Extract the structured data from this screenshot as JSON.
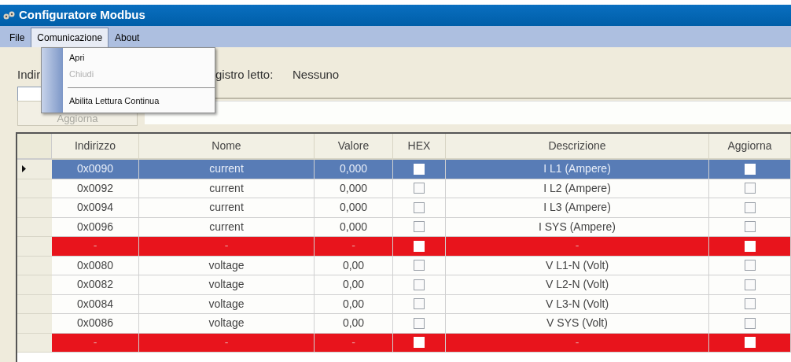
{
  "window": {
    "title": "Configuratore Modbus"
  },
  "menu_bar": [
    {
      "label": "File",
      "selected": false
    },
    {
      "label": "Comunicazione",
      "selected": true
    },
    {
      "label": "About",
      "selected": false
    }
  ],
  "open_menu": {
    "items": [
      {
        "label": "Apri",
        "disabled": false
      },
      {
        "label": "Chiudi",
        "disabled": true
      },
      {
        "kind": "separator"
      },
      {
        "label": "Abilita Lettura Continua",
        "disabled": false
      }
    ]
  },
  "form": {
    "address_label": "Indir",
    "register_label": "gistro letto:",
    "register_value": "Nessuno",
    "update_button": {
      "label": "Aggiorna",
      "disabled": true
    }
  },
  "table": {
    "columns": [
      "Indirizzo",
      "Nome",
      "Valore",
      "HEX",
      "Descrizione",
      "Aggiorna"
    ],
    "rows": [
      {
        "kind": "register",
        "selected": true,
        "address": "0x0090",
        "name": "current",
        "value": "0,000",
        "hex": false,
        "description": "I L1  (Ampere)",
        "update": false
      },
      {
        "kind": "register",
        "selected": false,
        "address": "0x0092",
        "name": "current",
        "value": "0,000",
        "hex": false,
        "description": "I L2  (Ampere)",
        "update": false
      },
      {
        "kind": "register",
        "selected": false,
        "address": "0x0094",
        "name": "current",
        "value": "0,000",
        "hex": false,
        "description": "I L3  (Ampere)",
        "update": false
      },
      {
        "kind": "register",
        "selected": false,
        "address": "0x0096",
        "name": "current",
        "value": "0,000",
        "hex": false,
        "description": "I SYS  (Ampere)",
        "update": false
      },
      {
        "kind": "separator",
        "selected": false,
        "address": "-",
        "name": "-",
        "value": "-",
        "hex": false,
        "description": "-",
        "update": false
      },
      {
        "kind": "register",
        "selected": false,
        "address": "0x0080",
        "name": "voltage",
        "value": "0,00",
        "hex": false,
        "description": "V L1-N (Volt)",
        "update": false
      },
      {
        "kind": "register",
        "selected": false,
        "address": "0x0082",
        "name": "voltage",
        "value": "0,00",
        "hex": false,
        "description": "V L2-N  (Volt)",
        "update": false
      },
      {
        "kind": "register",
        "selected": false,
        "address": "0x0084",
        "name": "voltage",
        "value": "0,00",
        "hex": false,
        "description": "V L3-N (Volt)",
        "update": false
      },
      {
        "kind": "register",
        "selected": false,
        "address": "0x0086",
        "name": "voltage",
        "value": "0,00",
        "hex": false,
        "description": "V SYS (Volt)",
        "update": false
      },
      {
        "kind": "separator",
        "selected": false,
        "address": "-",
        "name": "-",
        "value": "-",
        "hex": false,
        "description": "-",
        "update": false
      }
    ]
  }
}
